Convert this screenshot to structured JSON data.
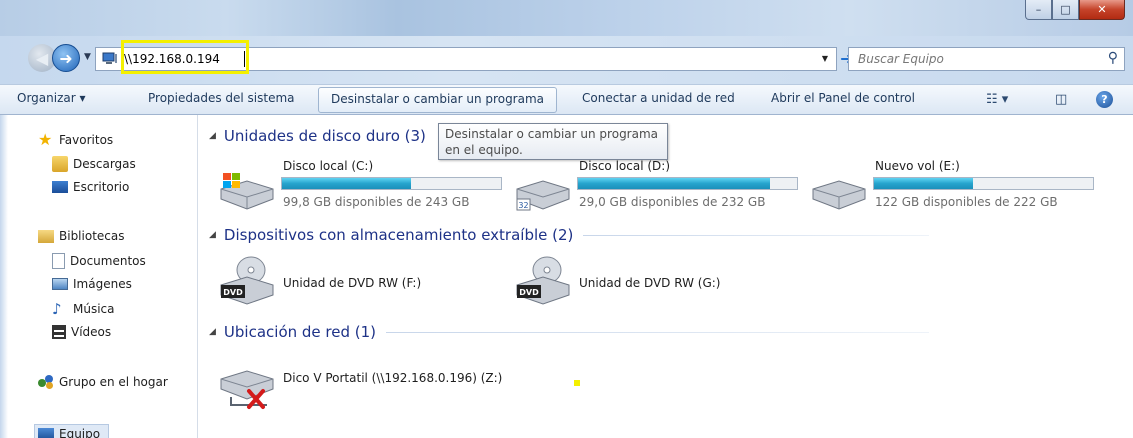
{
  "window": {
    "minimize_glyph": "–",
    "maximize_glyph": "□",
    "close_glyph": "✕"
  },
  "nav": {
    "address": "\\\\192.168.0.194",
    "search_placeholder": "Buscar Equipo"
  },
  "commands": {
    "organize": "Organizar ▾",
    "system_properties": "Propiedades del sistema",
    "uninstall": "Desinstalar o cambiar un programa",
    "map_drive": "Conectar a unidad de red",
    "control_panel": "Abrir el Panel de control",
    "help": "?"
  },
  "sidebar": {
    "favorites": "Favoritos",
    "downloads": "Descargas",
    "desktop": "Escritorio",
    "libraries": "Bibliotecas",
    "documents": "Documentos",
    "images": "Imágenes",
    "music": "Música",
    "videos": "Vídeos",
    "homegroup": "Grupo en el hogar",
    "computer": "Equipo"
  },
  "groups": {
    "hard_disks": "Unidades de disco duro (3)",
    "removable": "Dispositivos con almacenamiento extraíble (2)",
    "network": "Ubicación de red (1)"
  },
  "drives": [
    {
      "name": "Disco local (C:)",
      "free": "99,8 GB disponibles de 243 GB",
      "used_fraction": 0.59
    },
    {
      "name": "Disco local (D:)",
      "free": "29,0 GB disponibles de 232 GB",
      "used_fraction": 0.875
    },
    {
      "name": "Nuevo vol (E:)",
      "free": "122 GB disponibles de 222 GB",
      "used_fraction": 0.45
    }
  ],
  "dvd": [
    {
      "name": "Unidad de DVD RW (F:)"
    },
    {
      "name": "Unidad de DVD RW (G:)"
    }
  ],
  "network_drive": {
    "name": "Dico V Portatil (\\\\192.168.0.196) (Z:)"
  },
  "tooltip": {
    "line1": "Desinstalar o cambiar un programa",
    "line2": "en el equipo."
  },
  "colors": {
    "highlight": "#f4f000",
    "group_heading": "#1e3287",
    "bar_fill": "#26a4cd"
  }
}
